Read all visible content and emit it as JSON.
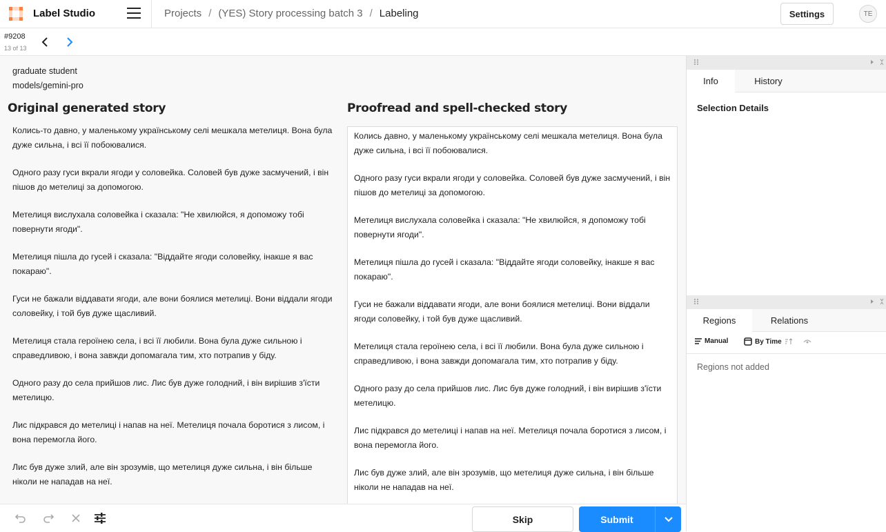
{
  "app": {
    "title": "Label Studio",
    "accent_color": "#ff7d3d",
    "primary_color": "#1a8cff"
  },
  "header": {
    "breadcrumb": [
      "Projects",
      "(YES) Story processing batch 3",
      "Labeling"
    ],
    "separator": "/",
    "settings_label": "Settings",
    "avatar_initials": "TE"
  },
  "task": {
    "id": "#9208",
    "position": "13 of 13"
  },
  "content": {
    "meta": [
      "graduate student",
      "models/gemini-pro"
    ],
    "left_title": "Original generated story",
    "right_title": "Proofread and spell-checked story",
    "left_paragraphs": [
      "Колись-то давно, у маленькому українському селі мешкала метелиця. Вона була дуже сильна, і всі її побоювалися.",
      "Одного разу гуси вкрали ягоди у соловейка. Соловей був дуже засмучений, і він пішов до метелиці за допомогою.",
      "Метелиця вислухала соловейка і сказала: \"Не хвилюйся, я допоможу тобі повернути ягоди\".",
      "Метелиця пішла до гусей і сказала: \"Віддайте ягоди соловейку, інакше я вас покараю\".",
      "Гуси не бажали віддавати ягоди, але вони боялися метелиці. Вони віддали ягоди соловейку, і той був дуже щасливий.",
      "Метелиця стала героїнею села, і всі її любили. Вона була дуже сильною і справедливою, і вона завжди допомагала тим, хто потрапив у біду.",
      "Одного разу до села прийшов лис. Лис був дуже голодний, і він вирішив з'їсти метелицю.",
      "Лис підкрався до метелиці і напав на неї. Метелиця почала боротися з лисом, і вона перемогла його.",
      "Лис був дуже злий, але він зрозумів, що метелиця дуже сильна, і він більше ніколи не нападав на неї."
    ],
    "right_paragraphs": [
      "Колись давно, у маленькому українському селі мешкала метелиця. Вона була дуже сильна, і всі її побоювалися.",
      "Одного разу гуси вкрали ягоди у соловейка. Соловей був дуже засмучений, і він пішов до метелиці за допомогою.",
      "Метелиця вислухала соловейка і сказала: \"Не хвилюйся, я допоможу тобі повернути ягоди\".",
      "Метелиця пішла до гусей і сказала: \"Віддайте ягоди соловейку, інакше я вас покараю\".",
      "Гуси не бажали віддавати ягоди, але вони боялися метелиці. Вони віддали ягоди соловейку, і той був дуже щасливий.",
      "Метелиця стала героїнею села, і всі її любили. Вона була дуже сильною і справедливою, і вона завжди допомагала тим, хто потрапив у біду.",
      "Одного разу до села прийшов лис. Лис був дуже голодний, і він вирішив з'їсти метелицю.",
      "Лис підкрався до метелиці і напав на неї. Метелиця почала боротися з лисом, і вона перемогла його.",
      "Лис був дуже злий, але він зрозумів, що метелиця дуже сильна, і він більше ніколи не нападав на неї."
    ]
  },
  "footer": {
    "skip_label": "Skip",
    "submit_label": "Submit"
  },
  "sidepanel": {
    "top_tabs": [
      "Info",
      "History"
    ],
    "selection_title": "Selection Details",
    "bottom_tabs": [
      "Regions",
      "Relations"
    ],
    "toolbar": {
      "manual_label": "Manual",
      "by_time_label": "By Time"
    },
    "empty_text": "Regions not added"
  },
  "icons": [
    "logo-icon",
    "hamburger-icon",
    "chevron-left-icon",
    "chevron-right-icon",
    "undo-icon",
    "redo-icon",
    "close-icon",
    "settings-sliders-icon",
    "chevron-down-icon",
    "grip-icon",
    "expand-icon",
    "collapse-icon",
    "list-icon",
    "clock-icon",
    "sort-icon",
    "eye-icon"
  ]
}
